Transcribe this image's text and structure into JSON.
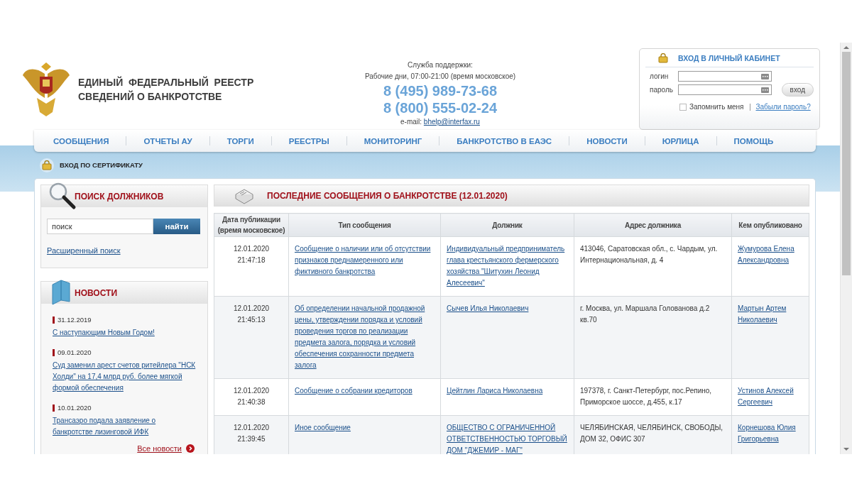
{
  "header": {
    "title_lines": [
      "ЕДИНЫЙ  ФЕДЕРАЛЬНЫЙ  РЕЕСТР",
      "СВЕДЕНИЙ О БАНКРОТСТВЕ"
    ]
  },
  "support": {
    "label": "Служба поддержки:",
    "hours": "Рабочие дни, 07:00-21:00 (время московское)",
    "phones": [
      "8 (495) 989-73-68",
      "8 (800) 555-02-24"
    ],
    "email_label": "e-mail:",
    "email": "bhelp@interfax.ru"
  },
  "login": {
    "title": "ВХОД В ЛИЧНЫЙ КАБИНЕТ",
    "login_label": "логин",
    "password_label": "пароль",
    "submit": "вход",
    "remember": {
      "label": "Запомнить меня",
      "checked": false
    },
    "forgot": "Забыли пароль?"
  },
  "nav": [
    "СООБЩЕНИЯ",
    "ОТЧЕТЫ АУ",
    "ТОРГИ",
    "РЕЕСТРЫ",
    "МОНИТОРИНГ",
    "БАНКРОТСТВО В ЕАЭС",
    "НОВОСТИ",
    "ЮРЛИЦА",
    "ПОМОЩЬ"
  ],
  "certificate_login": "ВХОД ПО СЕРТИФИКАТУ",
  "search": {
    "title": "ПОИСК ДОЛЖНИКОВ",
    "value": "поиск",
    "button": "найти",
    "advanced": "Расширенный поиск"
  },
  "news": {
    "title": "НОВОСТИ",
    "items": [
      {
        "date": "31.12.2019",
        "title": "С наступающим Новым Годом!"
      },
      {
        "date": "09.01.2020",
        "title": "Суд заменил арест счетов ритейлера \"НСК Холди\" на 17,4 млрд руб. более мягкой формой обеспечения"
      },
      {
        "date": "10.01.2020",
        "title": "Трансаэро подала заявление о банкротстве лизинговой ИФК"
      }
    ],
    "all": "Все новости"
  },
  "messages": {
    "title": "ПОСЛЕДНИЕ СООБЩЕНИЯ О БАНКРОТСТВЕ (12.01.2020)",
    "columns": [
      "Дата публикации\n(время московское)",
      "Тип сообщения",
      "Должник",
      "Адрес должника",
      "Кем опубликовано"
    ],
    "rows": [
      {
        "date": "12.01.2020",
        "time": "21:47:18",
        "type": "Сообщение о наличии или об отсутствии признаков преднамеренного или фиктивного банкротства",
        "debtor": "Индивидуальный предприниматель глава крестьянского фермерского хозяйства \"Шитухин Леонид Алесеевич\"",
        "address": "413046, Саратовская обл., с. Чардым, ул. Интернациональная, д. 4",
        "publisher": "Жумурова Елена Александровна"
      },
      {
        "date": "12.01.2020",
        "time": "21:45:13",
        "type": "Об определении начальной продажной цены, утверждении порядка и условий проведения торгов по реализации предмета залога, порядка и условий обеспечения сохранности предмета залога",
        "debtor": "Сычев Илья Николаевич",
        "address": "г. Москва, ул. Маршала Голованова д.2 кв.70",
        "publisher": "Мартын Артем Николаевич"
      },
      {
        "date": "12.01.2020",
        "time": "21:40:38",
        "type": "Сообщение о собрании кредиторов",
        "debtor": "Цейтлин Лариса Николаевна",
        "address": "197378, г. Санкт-Петербург, пос.Репино, Приморское шоссе, д.455, к.17",
        "publisher": "Устинов Алексей Сергеевич"
      },
      {
        "date": "12.01.2020",
        "time": "21:39:45",
        "type": "Иное сообщение",
        "debtor": "ОБЩЕСТВО С ОГРАНИЧЕННОЙ ОТВЕТСТВЕННОСТЬЮ ТОРГОВЫЙ ДОМ \"ДЖЕМИР - МАГ\"",
        "address": "ЧЕЛЯБИНСКАЯ, ЧЕЛЯБИНСК, СВОБОДЫ, ДОМ 32, ОФИС 307",
        "publisher": "Корнешова Юлия Григорьевна"
      }
    ]
  }
}
